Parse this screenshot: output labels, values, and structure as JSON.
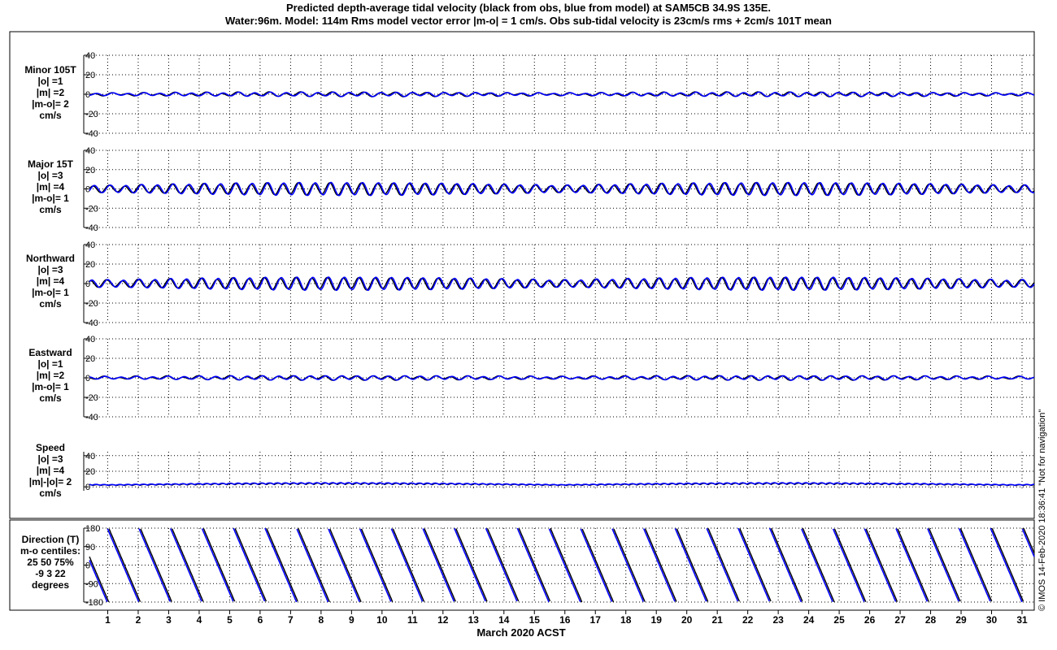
{
  "chart_data": {
    "type": "line",
    "title": "Predicted depth-average tidal velocity (black from obs, blue from model) at SAM5CB 34.9S 135E.",
    "subtitle": "Water:96m. Model: 114m  Rms model vector error |m-o| = 1 cm/s. Obs sub-tidal velocity is 23cm/s rms + 2cm/s 101T mean",
    "xlabel": "March 2020 ACST",
    "x_ticks": [
      "1",
      "2",
      "3",
      "4",
      "5",
      "6",
      "7",
      "8",
      "9",
      "10",
      "11",
      "12",
      "13",
      "14",
      "15",
      "16",
      "17",
      "18",
      "19",
      "20",
      "21",
      "22",
      "23",
      "24",
      "25",
      "26",
      "27",
      "28",
      "29",
      "30",
      "31"
    ],
    "xlim": [
      0.4,
      31.4
    ],
    "grid": true,
    "colors": {
      "obs": "#000000",
      "model": "#0000ff"
    },
    "credit": "© IMOS 14-Feb-2020 18:36:41  \"Not for navigation\"",
    "panels": [
      {
        "lines": [
          "Minor 105T",
          "|o| =1",
          "|m| =2",
          "|m-o|= 2",
          "cm/s"
        ],
        "yticks": [
          "40",
          "20",
          "0",
          "-20",
          "-40"
        ],
        "ylim": [
          -40,
          40
        ],
        "series": [
          {
            "name": "obs",
            "amp_obs_cm_s": 1
          },
          {
            "name": "model",
            "amp_model_cm_s": 2
          }
        ]
      },
      {
        "lines": [
          "Major 15T",
          "|o| =3",
          "|m| =4",
          "|m-o|= 1",
          "cm/s"
        ],
        "yticks": [
          "40",
          "20",
          "0",
          "-20",
          "-40"
        ],
        "ylim": [
          -40,
          40
        ],
        "series": [
          {
            "name": "obs",
            "amp_obs_cm_s": 3
          },
          {
            "name": "model",
            "amp_model_cm_s": 4
          }
        ]
      },
      {
        "lines": [
          "Northward",
          "|o| =3",
          "|m| =4",
          "|m-o|= 1",
          "cm/s"
        ],
        "yticks": [
          "40",
          "20",
          "0",
          "-20",
          "-40"
        ],
        "ylim": [
          -40,
          40
        ],
        "series": [
          {
            "name": "obs",
            "amp_obs_cm_s": 3
          },
          {
            "name": "model",
            "amp_model_cm_s": 4
          }
        ]
      },
      {
        "lines": [
          "Eastward",
          "|o| =1",
          "|m| =2",
          "|m-o|= 1",
          "cm/s"
        ],
        "yticks": [
          "40",
          "20",
          "0",
          "-20",
          "-40"
        ],
        "ylim": [
          -40,
          40
        ],
        "series": [
          {
            "name": "obs",
            "amp_obs_cm_s": 1
          },
          {
            "name": "model",
            "amp_model_cm_s": 2
          }
        ]
      },
      {
        "lines": [
          "Speed",
          "|o| =3",
          "|m| =4",
          "|m|-|o|= 2",
          "cm/s"
        ],
        "yticks": [
          "40",
          "20",
          "0"
        ],
        "ylim": [
          -5,
          45
        ],
        "series": [
          {
            "name": "obs",
            "amp_obs_cm_s": 3
          },
          {
            "name": "model",
            "amp_model_cm_s": 4
          }
        ]
      },
      {
        "lines": [
          "Direction (T)",
          "m-o centiles:",
          "25  50  75%",
          "-9   3  22",
          "degrees"
        ],
        "yticks": [
          "180",
          "90",
          "0",
          "-90",
          "-180"
        ],
        "ylim": [
          -180,
          180
        ],
        "series": [
          {
            "name": "obs"
          },
          {
            "name": "model"
          }
        ]
      }
    ]
  }
}
